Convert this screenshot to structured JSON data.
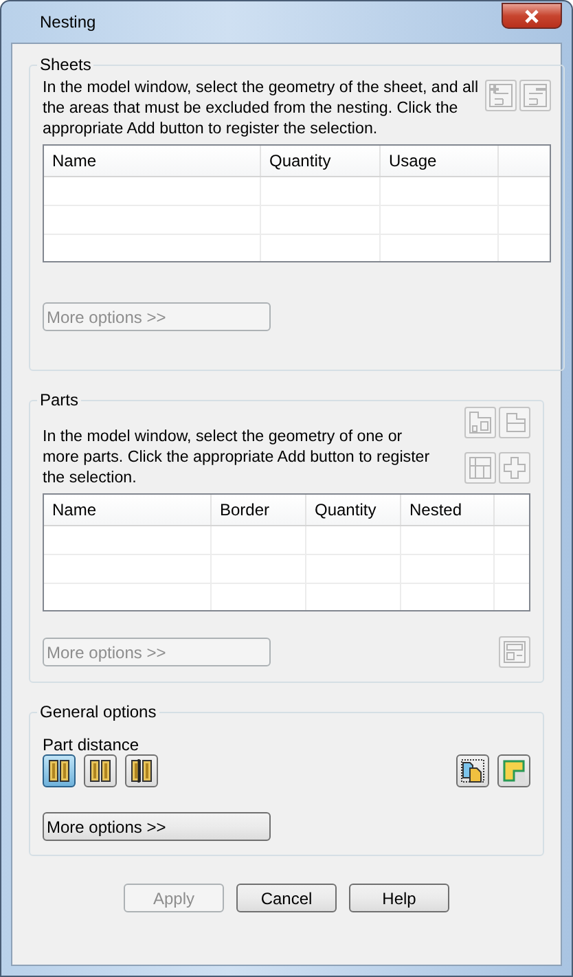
{
  "window": {
    "title": "Nesting"
  },
  "sheets": {
    "title": "Sheets",
    "description": "In the model window, select the geometry of the sheet, and all the areas that must be excluded from the nesting. Click the appropriate Add button to register the selection.",
    "tool_buttons": [
      {
        "disabled": true
      },
      {
        "disabled": true
      }
    ],
    "table": {
      "columns": [
        "Name",
        "Quantity",
        "Usage"
      ]
    },
    "more_options": {
      "label": "More options >>",
      "disabled": true
    }
  },
  "parts": {
    "title": "Parts",
    "description": "In the model window, select the geometry of one or more parts. Click the appropriate Add button to register the selection.",
    "tool_buttons": [
      {
        "disabled": true
      },
      {
        "disabled": true
      },
      {
        "disabled": true
      },
      {
        "disabled": true
      }
    ],
    "table": {
      "columns": [
        "Name",
        "Border",
        "Quantity",
        "Nested"
      ]
    },
    "more_options": {
      "label": "More options >>",
      "disabled": true
    },
    "extra_button": {
      "disabled": true
    }
  },
  "general": {
    "title": "General options",
    "part_distance_label": "Part distance",
    "part_distance_modes": [
      {
        "selected": true
      },
      {
        "selected": false
      },
      {
        "selected": false
      }
    ],
    "more_options": {
      "label": "More options >>",
      "disabled": false
    }
  },
  "footer_buttons": [
    {
      "label": "Apply",
      "disabled": true
    },
    {
      "label": "Cancel",
      "disabled": false
    },
    {
      "label": "Help",
      "disabled": false
    }
  ]
}
